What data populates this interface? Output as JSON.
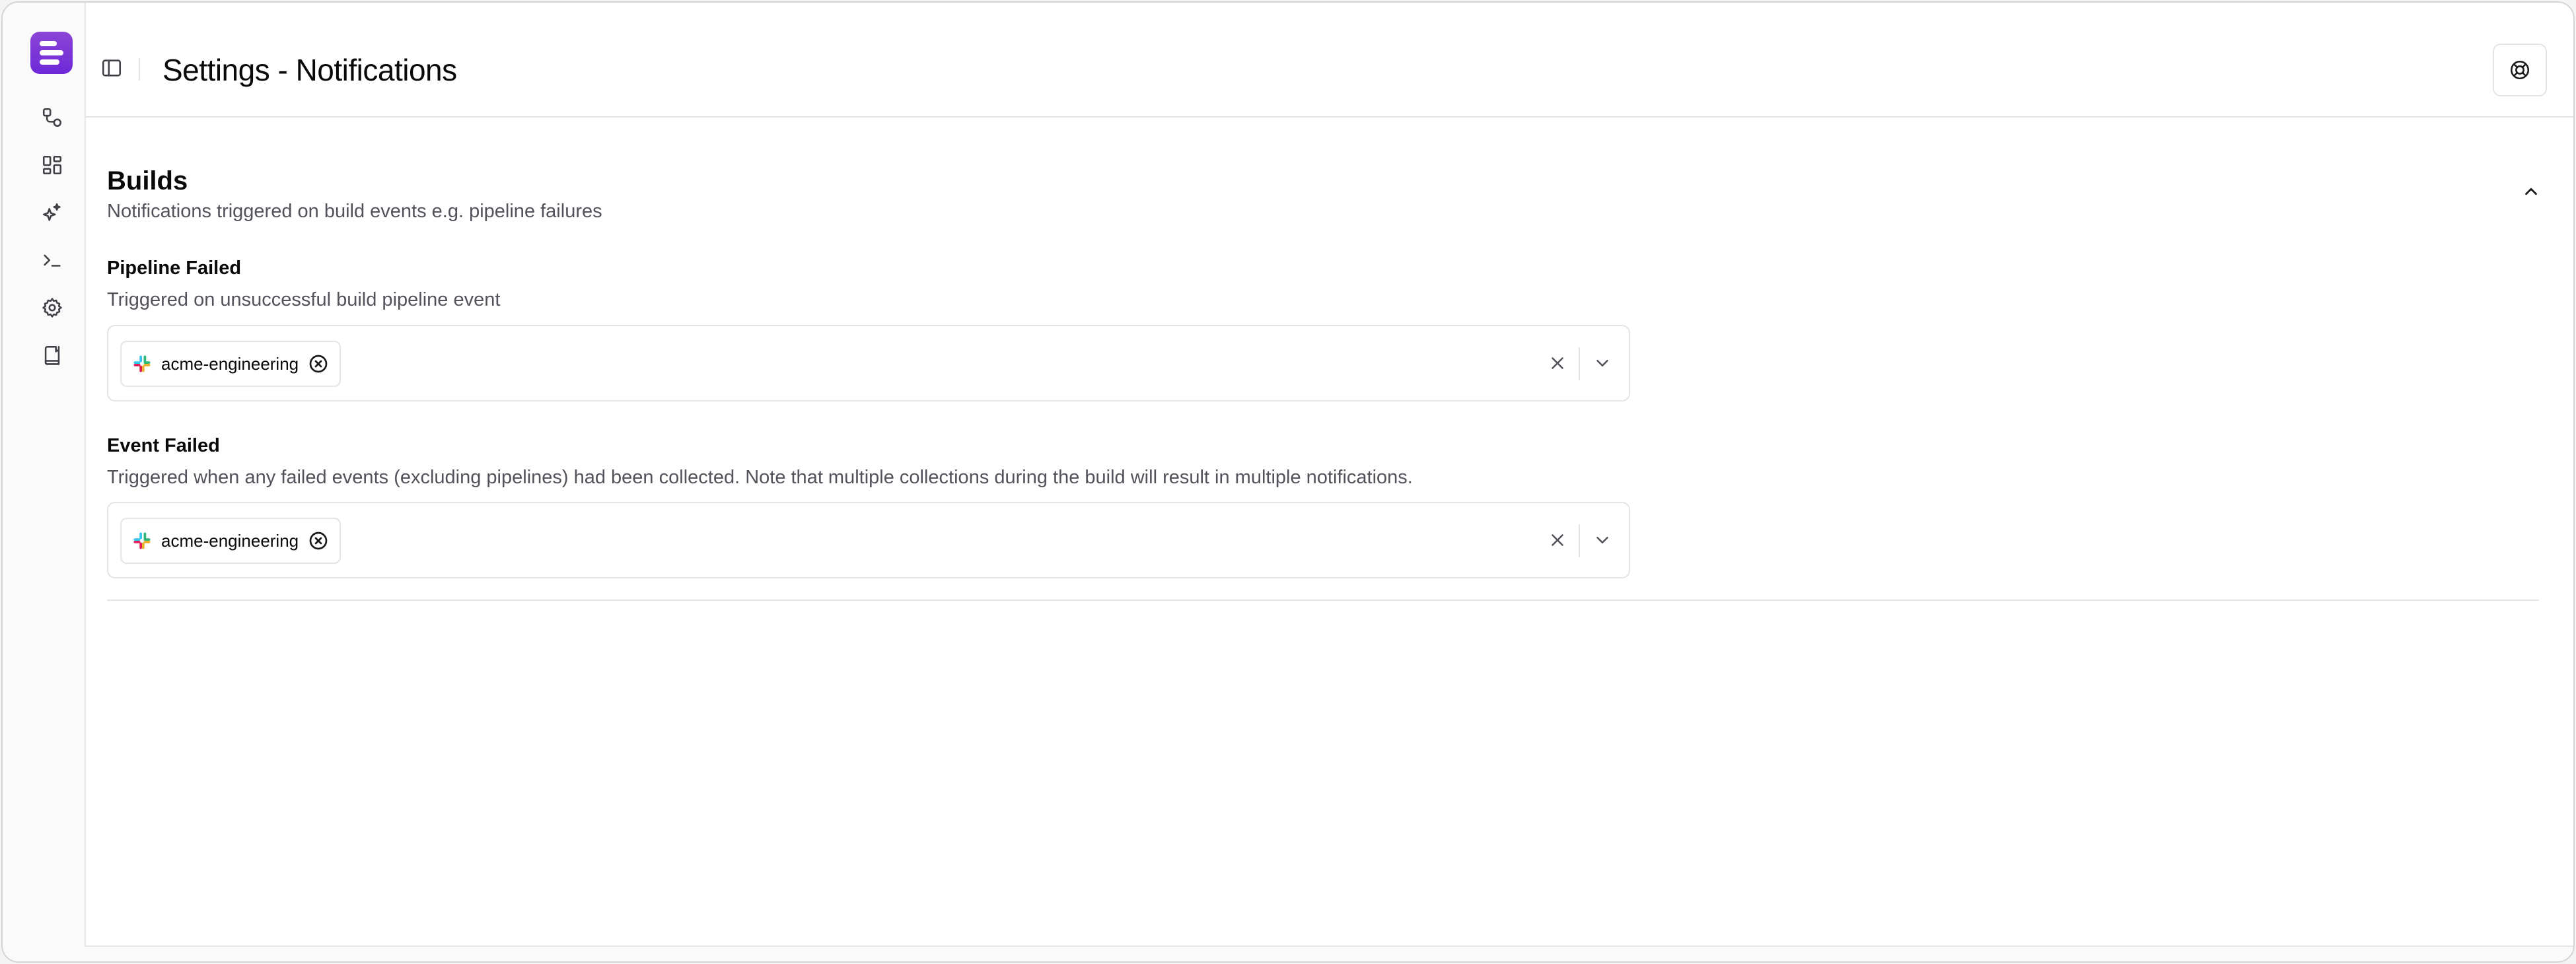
{
  "header": {
    "title": "Settings - Notifications"
  },
  "rail": {
    "items": [
      {
        "icon": "workflow-icon"
      },
      {
        "icon": "dashboard-icon"
      },
      {
        "icon": "sparkles-icon"
      },
      {
        "icon": "terminal-icon"
      },
      {
        "icon": "gear-icon"
      },
      {
        "icon": "book-icon"
      }
    ]
  },
  "section": {
    "title": "Builds",
    "description": "Notifications triggered on build events e.g. pipeline failures",
    "fields": [
      {
        "label": "Pipeline Failed",
        "description": "Triggered on unsuccessful build pipeline event",
        "selected": [
          "acme-engineering"
        ]
      },
      {
        "label": "Event Failed",
        "description": "Triggered when any failed events (excluding pipelines) had been collected. Note that multiple collections during the build will result in multiple notifications.",
        "selected": [
          "acme-engineering"
        ]
      }
    ]
  },
  "colors": {
    "brand": "#7c3aed",
    "border": "#e4e4e7",
    "muted_text": "#52525b"
  }
}
